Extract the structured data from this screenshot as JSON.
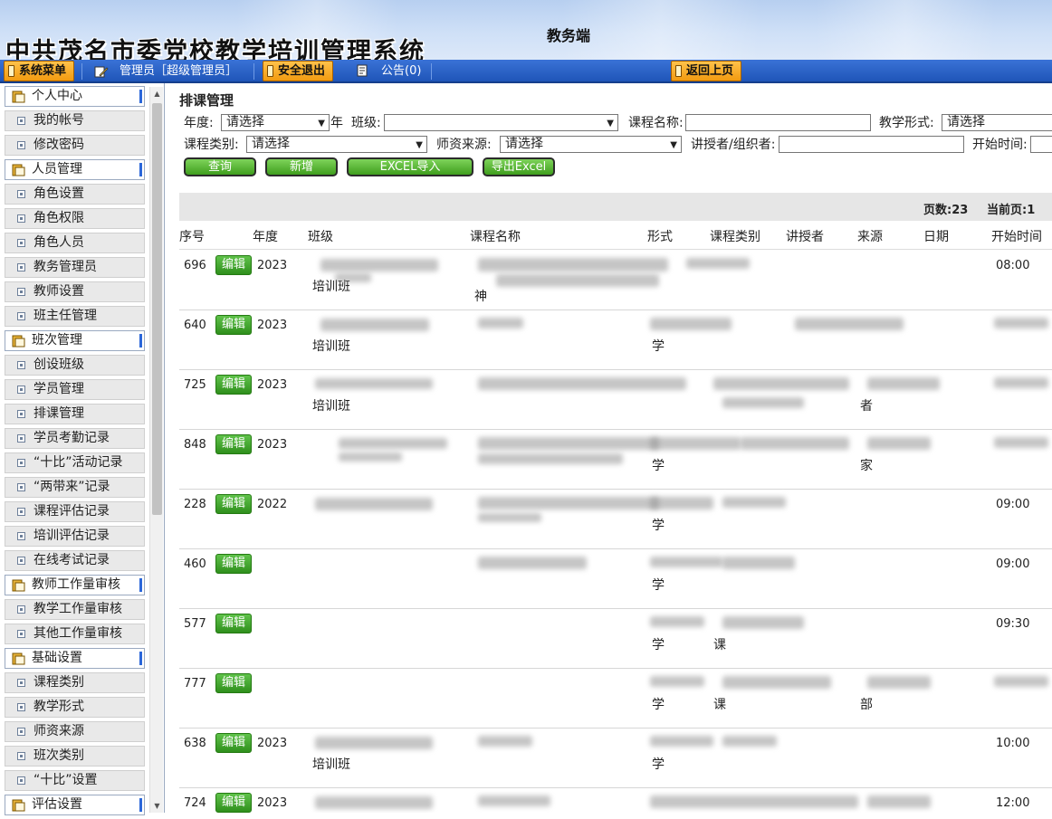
{
  "app": {
    "title": "中共茂名市委党校教学培训管理系统",
    "subtitle": "教务端"
  },
  "toolbar": {
    "system_menu": "系统菜单",
    "user_label": "管理员［超级管理员］",
    "logout": "安全退出",
    "notice": "公告(0)",
    "back": "返回上页"
  },
  "sidebar": {
    "items": [
      {
        "type": "group",
        "label": "个人中心"
      },
      {
        "type": "sub",
        "label": "我的帐号"
      },
      {
        "type": "sub",
        "label": "修改密码"
      },
      {
        "type": "group",
        "label": "人员管理"
      },
      {
        "type": "sub",
        "label": "角色设置"
      },
      {
        "type": "sub",
        "label": "角色权限"
      },
      {
        "type": "sub",
        "label": "角色人员"
      },
      {
        "type": "sub",
        "label": "教务管理员"
      },
      {
        "type": "sub",
        "label": "教师设置"
      },
      {
        "type": "sub",
        "label": "班主任管理"
      },
      {
        "type": "group",
        "label": "班次管理"
      },
      {
        "type": "sub",
        "label": "创设班级"
      },
      {
        "type": "sub",
        "label": "学员管理"
      },
      {
        "type": "sub",
        "label": "排课管理"
      },
      {
        "type": "sub",
        "label": "学员考勤记录"
      },
      {
        "type": "sub",
        "label": "“十比”活动记录"
      },
      {
        "type": "sub",
        "label": "“两带来”记录"
      },
      {
        "type": "sub",
        "label": "课程评估记录"
      },
      {
        "type": "sub",
        "label": "培训评估记录"
      },
      {
        "type": "sub",
        "label": "在线考试记录"
      },
      {
        "type": "group",
        "label": "教师工作量审核"
      },
      {
        "type": "sub",
        "label": "教学工作量审核"
      },
      {
        "type": "sub",
        "label": "其他工作量审核"
      },
      {
        "type": "group",
        "label": "基础设置"
      },
      {
        "type": "sub",
        "label": "课程类别"
      },
      {
        "type": "sub",
        "label": "教学形式"
      },
      {
        "type": "sub",
        "label": "师资来源"
      },
      {
        "type": "sub",
        "label": "班次类别"
      },
      {
        "type": "sub",
        "label": "“十比”设置"
      },
      {
        "type": "group",
        "label": "评估设置"
      }
    ]
  },
  "main": {
    "title": "排课管理",
    "filters": {
      "year_label": "年度:",
      "year_value": "请选择",
      "year_suffix": "年",
      "class_label": "班级:",
      "class_value": "",
      "course_label": "课程名称:",
      "course_value": "",
      "form_label": "教学形式:",
      "form_value": "请选择",
      "type_label": "课程类别:",
      "type_value": "请选择",
      "source_label": "师资来源:",
      "source_value": "请选择",
      "lecturer_label": "讲授者/组织者:",
      "lecturer_value": "",
      "start_label": "开始时间:"
    },
    "buttons": {
      "query": "查询",
      "add": "新增",
      "import": "EXCEL导入",
      "export": "导出Excel"
    },
    "pager": {
      "pages": "页数:23",
      "current": "当前页:1"
    },
    "columns": [
      "序号",
      "年度",
      "班级",
      "课程名称",
      "形式",
      "课程类别",
      "讲授者",
      "来源",
      "日期",
      "开始时间"
    ],
    "edit_label": "编辑",
    "rows": [
      {
        "id": "696",
        "year": "2023",
        "class_line2": "培训班",
        "course_line2": "神",
        "form": "",
        "ctype": "",
        "lecturer": "",
        "source": "",
        "time": "08:00"
      },
      {
        "id": "640",
        "year": "2023",
        "class_line2": "培训班",
        "course_line2": "",
        "form": "学",
        "ctype": "",
        "lecturer": "",
        "source": "",
        "time": ""
      },
      {
        "id": "725",
        "year": "2023",
        "class_line2": "培训班",
        "course_line2": "",
        "form": "",
        "ctype": "",
        "lecturer": "",
        "source": "者",
        "time": ""
      },
      {
        "id": "848",
        "year": "2023",
        "class_line2": "",
        "course_line2": "",
        "form": "学",
        "ctype": "",
        "lecturer": "",
        "source": "家",
        "time": ""
      },
      {
        "id": "228",
        "year": "2022",
        "class_line2": "",
        "course_line2": "",
        "form": "学",
        "ctype": "",
        "lecturer": "",
        "source": "",
        "time": "09:00"
      },
      {
        "id": "460",
        "year": "",
        "class_line2": "",
        "course_line2": "",
        "form": "学",
        "ctype": "",
        "lecturer": "",
        "source": "",
        "time": "09:00"
      },
      {
        "id": "577",
        "year": "",
        "class_line2": "",
        "course_line2": "",
        "form": "学",
        "ctype": "课",
        "lecturer": "",
        "source": "",
        "time": "09:30"
      },
      {
        "id": "777",
        "year": "",
        "class_line2": "",
        "course_line2": "",
        "form": "学",
        "ctype": "课",
        "lecturer": "",
        "source": "部",
        "time": ""
      },
      {
        "id": "638",
        "year": "2023",
        "class_line2": "培训班",
        "course_line2": "",
        "form": "学",
        "ctype": "",
        "lecturer": "",
        "source": "",
        "time": "10:00"
      },
      {
        "id": "724",
        "year": "2023",
        "class_line2": "",
        "course_line2": "",
        "form": "",
        "ctype": "",
        "lecturer": "",
        "source": "",
        "time": "12:00"
      }
    ]
  },
  "colors": {
    "toolbar_blue": "#2660c8",
    "orange_button": "#f5a623",
    "green_button": "#3f9e1d",
    "header_bg": "#cfe0f7"
  }
}
